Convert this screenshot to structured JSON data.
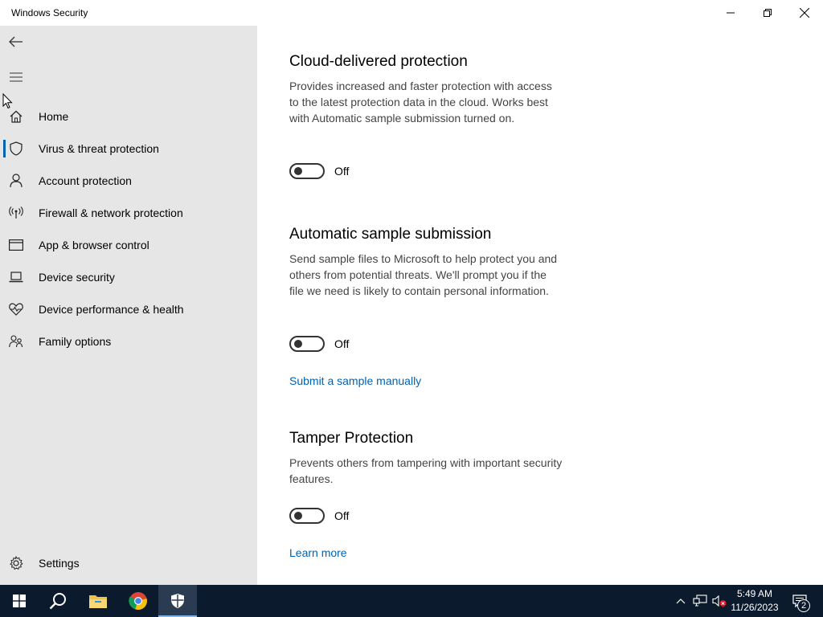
{
  "window": {
    "title": "Windows Security"
  },
  "sidebar": {
    "items": [
      {
        "label": "Home",
        "icon": "home-icon"
      },
      {
        "label": "Virus & threat protection",
        "icon": "shield-icon",
        "active": true
      },
      {
        "label": "Account protection",
        "icon": "person-icon"
      },
      {
        "label": "Firewall & network protection",
        "icon": "antenna-icon"
      },
      {
        "label": "App & browser control",
        "icon": "browser-window-icon"
      },
      {
        "label": "Device security",
        "icon": "laptop-icon"
      },
      {
        "label": "Device performance & health",
        "icon": "heart-pulse-icon"
      },
      {
        "label": "Family options",
        "icon": "family-icon"
      }
    ],
    "settings_label": "Settings"
  },
  "main": {
    "sections": [
      {
        "heading": "Cloud-delivered protection",
        "description": "Provides increased and faster protection with access to the latest protection data in the cloud. Works best with Automatic sample submission turned on.",
        "toggle_state": "Off",
        "toggle_on": false
      },
      {
        "heading": "Automatic sample submission",
        "description": "Send sample files to Microsoft to help protect you and others from potential threats. We'll prompt you if the file we need is likely to contain personal information.",
        "toggle_state": "Off",
        "toggle_on": false,
        "link": "Submit a sample manually"
      },
      {
        "heading": "Tamper Protection",
        "description": "Prevents others from tampering with important security features.",
        "toggle_state": "Off",
        "toggle_on": false,
        "link": "Learn more"
      }
    ]
  },
  "taskbar": {
    "time": "5:49 AM",
    "date": "11/26/2023",
    "notification_count": "2"
  },
  "colors": {
    "accent": "#0063b1",
    "sidebar_bg": "#e6e6e6",
    "taskbar_bg": "#0b1a2c"
  }
}
